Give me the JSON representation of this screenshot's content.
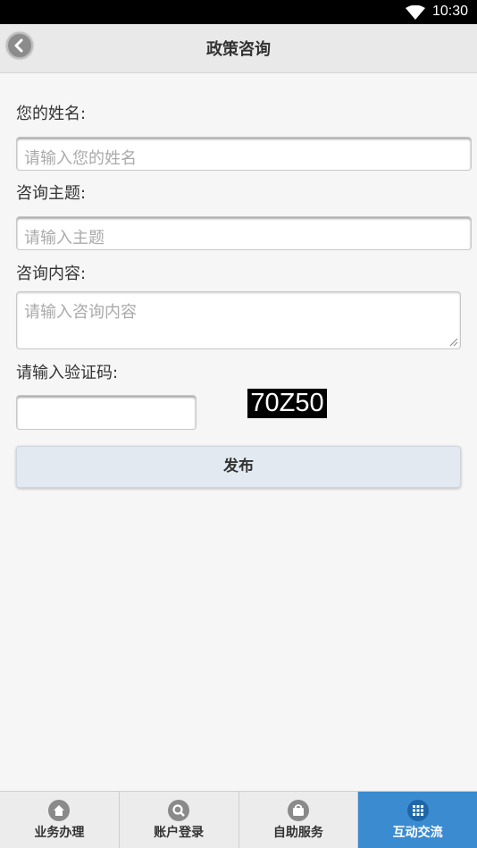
{
  "status_bar": {
    "time": "10:30"
  },
  "header": {
    "title": "政策咨询"
  },
  "form": {
    "name_label": "您的姓名:",
    "name_placeholder": "请输入您的姓名",
    "subject_label": "咨询主题:",
    "subject_placeholder": "请输入主题",
    "content_label": "咨询内容:",
    "content_placeholder": "请输入咨询内容",
    "captcha_label": "请输入验证码:",
    "captcha_value": "",
    "captcha_text": "70Z50",
    "submit_label": "发布"
  },
  "tabbar": {
    "items": [
      {
        "label": "业务办理",
        "icon": "home-icon"
      },
      {
        "label": "账户登录",
        "icon": "search-icon"
      },
      {
        "label": "自助服务",
        "icon": "bag-icon"
      },
      {
        "label": "互动交流",
        "icon": "grid-icon",
        "active": true
      }
    ]
  },
  "colors": {
    "active_tab": "#3b8bd0",
    "header_bg": "#e9e9e9",
    "submit_bg": "#e3e9f1"
  }
}
